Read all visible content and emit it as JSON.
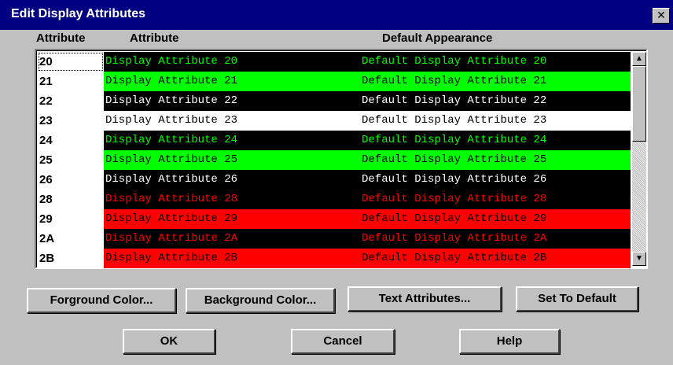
{
  "window": {
    "title": "Edit Display Attributes",
    "close_glyph": "✕"
  },
  "headers": {
    "attribute_id": "Attribute",
    "attribute": "Attribute",
    "default_appearance": "Default Appearance"
  },
  "rows": [
    {
      "id": "20",
      "attribute": "Display Attribute 20",
      "default": "Default Display Attribute 20",
      "fg": "#00ff00",
      "bg": "#000000",
      "underline": false
    },
    {
      "id": "21",
      "attribute": "Display Attribute 21",
      "default": "Default Display Attribute 21",
      "fg": "#000000",
      "bg": "#00ff00",
      "underline": false
    },
    {
      "id": "22",
      "attribute": "Display Attribute 22",
      "default": "Default Display Attribute 22",
      "fg": "#ffffff",
      "bg": "#000000",
      "underline": false
    },
    {
      "id": "23",
      "attribute": "Display Attribute 23",
      "default": "Default Display Attribute 23",
      "fg": "#000000",
      "bg": "#ffffff",
      "underline": false
    },
    {
      "id": "24",
      "attribute": "Display Attribute 24",
      "default": "Default Display Attribute 24",
      "fg": "#00ff00",
      "bg": "#000000",
      "underline": true
    },
    {
      "id": "25",
      "attribute": "Display Attribute 25",
      "default": "Default Display Attribute 25",
      "fg": "#000000",
      "bg": "#00ff00",
      "underline": true
    },
    {
      "id": "26",
      "attribute": "Display Attribute 26",
      "default": "Default Display Attribute 26",
      "fg": "#ffffff",
      "bg": "#000000",
      "underline": true
    },
    {
      "id": "28",
      "attribute": "Display Attribute 28",
      "default": "Default Display Attribute 28",
      "fg": "#ff0000",
      "bg": "#000000",
      "underline": false
    },
    {
      "id": "29",
      "attribute": "Display Attribute 29",
      "default": "Default Display Attribute 29",
      "fg": "#000000",
      "bg": "#ff0000",
      "underline": false
    },
    {
      "id": "2A",
      "attribute": "Display Attribute 2A",
      "default": "Default Display Attribute 2A",
      "fg": "#ff0000",
      "bg": "#000000",
      "underline": false
    },
    {
      "id": "2B",
      "attribute": "Display Attribute 2B",
      "default": "Default Display Attribute 2B",
      "fg": "#000000",
      "bg": "#ff0000",
      "underline": false
    }
  ],
  "scrollbar": {
    "up_icon": "▲",
    "down_icon": "▼"
  },
  "buttons": {
    "foreground": "Forground Color...",
    "background": "Background Color...",
    "text_attributes": "Text Attributes...",
    "set_default": "Set To Default",
    "ok": "OK",
    "cancel": "Cancel",
    "help": "Help"
  }
}
